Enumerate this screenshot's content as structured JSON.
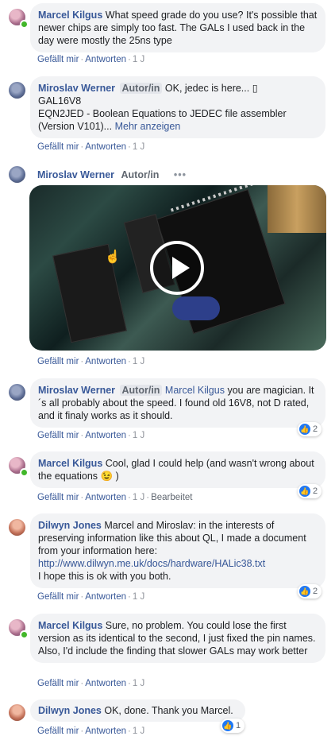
{
  "comments": [
    {
      "name": "Marcel Kilgus",
      "text": "What speed grade do you use? It's possible that newer chips are simply too fast. The GALs I used back in the day were mostly the 25ns type",
      "actions": {
        "like": "Gefällt mir",
        "reply": "Antworten",
        "time": "1 J"
      }
    },
    {
      "name": "Miroslav Werner",
      "tag": "Autor/in",
      "line1": "OK, jedec is here... ▯",
      "line2": "GAL16V8",
      "line3": "EQN2JED - Boolean Equations to JEDEC file assembler",
      "line4": "(Version V101)...",
      "more": "Mehr anzeigen",
      "actions": {
        "like": "Gefällt mir",
        "reply": "Antworten",
        "time": "1 J"
      }
    },
    {
      "name": "Miroslav Werner",
      "tag": "Autor/in",
      "dots": "•••",
      "actions": {
        "like": "Gefällt mir",
        "reply": "Antworten",
        "time": "1 J"
      }
    },
    {
      "name": "Miroslav Werner",
      "tag": "Autor/in",
      "mention": "Marcel Kilgus",
      "text": "you are magician. It´s all probably about the speed. I found old 16V8, not D rated, and it finaly works as it should.",
      "reactions": "2",
      "actions": {
        "like": "Gefällt mir",
        "reply": "Antworten",
        "time": "1 J"
      }
    },
    {
      "name": "Marcel Kilgus",
      "text": "Cool, glad I could help (and wasn't wrong about the equations",
      "emoji": "😉",
      "text_end": ")",
      "reactions": "2",
      "actions": {
        "like": "Gefällt mir",
        "reply": "Antworten",
        "time": "1 J",
        "edited": "Bearbeitet"
      }
    },
    {
      "name": "Dilwyn Jones",
      "text": "Marcel and Miroslav: in the interests of preserving information like this about QL, I made a document from your information here:",
      "link": "http://www.dilwyn.me.uk/docs/hardware/HALic38.txt",
      "text2": "I hope this is ok with you both.",
      "reactions": "2",
      "actions": {
        "like": "Gefällt mir",
        "reply": "Antworten",
        "time": "1 J"
      }
    },
    {
      "name": "Marcel Kilgus",
      "text": "Sure, no problem. You could lose the first version as its identical to the second, I just fixed the pin names. Also, I'd include the finding that slower GALs may work better",
      "actions": {
        "like": "Gefällt mir",
        "reply": "Antworten",
        "time": "1 J"
      }
    },
    {
      "name": "Dilwyn Jones",
      "text": "OK, done. Thank you Marcel.",
      "reactions": "1",
      "actions": {
        "like": "Gefällt mir",
        "reply": "Antworten",
        "time": "1 J"
      }
    }
  ],
  "icons": {
    "like": "thumbs-up-icon",
    "play": "play-icon"
  },
  "colors": {
    "name": "#385898",
    "bubble": "#f2f3f5",
    "like": "#2078f4",
    "online": "#42b72a"
  }
}
